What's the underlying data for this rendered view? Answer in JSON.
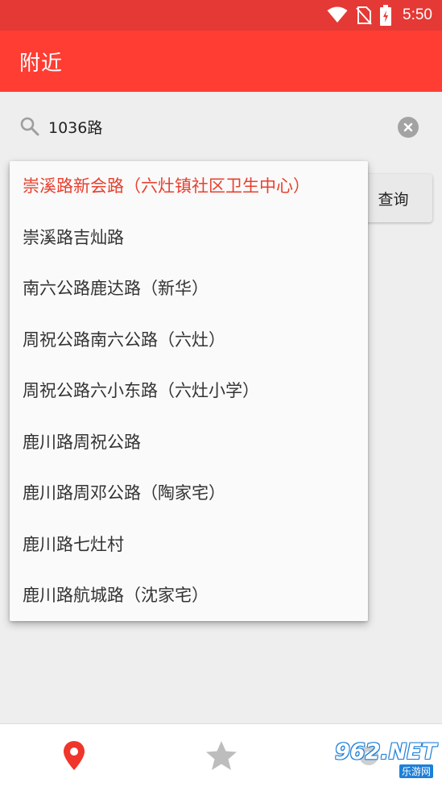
{
  "status_bar": {
    "time": "5:50",
    "icons": [
      "wifi-icon",
      "no-sim-icon",
      "battery-charging-icon"
    ]
  },
  "app_bar": {
    "title": "附近"
  },
  "search": {
    "value": "1036路",
    "placeholder": ""
  },
  "query_button": {
    "label": "查询"
  },
  "suggestions": [
    "崇溪路新会路（六灶镇社区卫生中心）",
    "崇溪路吉灿路",
    "南六公路鹿达路（新华）",
    "周祝公路南六公路（六灶）",
    "周祝公路六小东路（六灶小学）",
    "鹿川路周祝公路",
    "鹿川路周邓公路（陶家宅）",
    "鹿川路七灶村",
    "鹿川路航城路（沈家宅）"
  ],
  "bottom_nav": {
    "items": [
      {
        "icon": "location-pin-icon",
        "active": true
      },
      {
        "icon": "star-icon",
        "active": false
      },
      {
        "icon": "settings-icon",
        "active": false
      }
    ]
  },
  "watermark": {
    "main": "962.NET",
    "sub": "乐游网"
  },
  "colors": {
    "primary": "#ff3d33",
    "status_bar": "#e53935",
    "active_text": "#e8402f",
    "inactive_icon": "#bdbdbd"
  }
}
